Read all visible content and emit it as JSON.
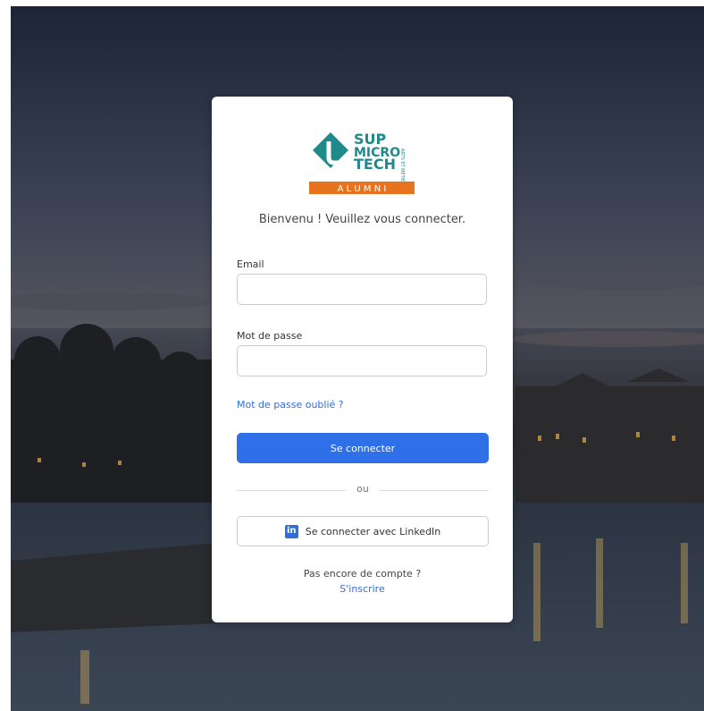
{
  "brand": {
    "logo_line1": "SUP",
    "logo_line2": "MICRO",
    "logo_line3": "TECH",
    "logo_side": "ARTS ET MÉTIERS",
    "logo_banner": "A L U M N I",
    "teal": "#1f8a8c",
    "blue": "#1a5aa0",
    "orange": "#e8731f"
  },
  "login": {
    "welcome": "Bienvenu ! Veuillez vous connecter.",
    "email_label": "Email",
    "email_value": "",
    "email_placeholder": "",
    "password_label": "Mot de passe",
    "password_value": "",
    "password_placeholder": "",
    "forgot_link": "Mot de passe oublié ?",
    "submit_label": "Se connecter",
    "separator": "ou",
    "linkedin_label": "Se connecter avec LinkedIn",
    "linkedin_icon": "in",
    "no_account": "Pas encore de compte ?",
    "signup_link": "S'inscrire"
  },
  "colors": {
    "primary": "#2f6fe8",
    "link": "#2f6fd6"
  }
}
